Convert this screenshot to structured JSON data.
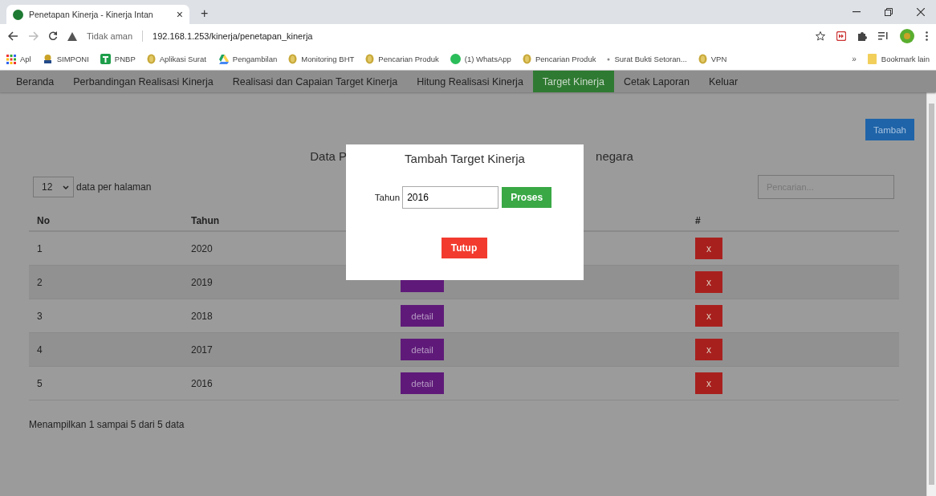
{
  "browser": {
    "tab_title": "Penetapan Kinerja - Kinerja Intan",
    "tab_close": "×",
    "new_tab": "+",
    "security": "Tidak aman",
    "url": "192.168.1.253/kinerja/penetapan_kinerja",
    "bookmarks": [
      {
        "label": "Apl",
        "kind": "grid"
      },
      {
        "label": "SIMPONI",
        "kind": "emblem"
      },
      {
        "label": "PNBP",
        "kind": "sheet"
      },
      {
        "label": "Aplikasi Surat",
        "kind": "coin"
      },
      {
        "label": "Pengambilan",
        "kind": "drive"
      },
      {
        "label": "Monitoring BHT",
        "kind": "coin"
      },
      {
        "label": "Pencarian Produk",
        "kind": "coin"
      },
      {
        "label": "(1) WhatsApp",
        "kind": "chat"
      },
      {
        "label": "Pencarian Produk",
        "kind": "coin"
      },
      {
        "label": "Surat Bukti Setoran...",
        "kind": "dot"
      },
      {
        "label": "VPN",
        "kind": "coin"
      }
    ],
    "more": "»",
    "other_bookmarks": "Bookmark lain"
  },
  "nav": [
    {
      "label": "Beranda",
      "selected": false
    },
    {
      "label": "Perbandingan Realisasi Kinerja",
      "selected": false
    },
    {
      "label": "Realisasi dan Capaian Target Kinerja",
      "selected": false
    },
    {
      "label": "Hitung Realisasi Kinerja",
      "selected": false
    },
    {
      "label": "Target Kinerja",
      "selected": true
    },
    {
      "label": "Cetak Laporan",
      "selected": false
    },
    {
      "label": "Keluar",
      "selected": false
    }
  ],
  "page": {
    "add_button": "Tambah",
    "title_left": "Data P",
    "title_right": "negara",
    "page_size": "12",
    "page_size_label": "data per halaman",
    "search": {
      "placeholder": "Pencarian..."
    },
    "columns": [
      "No",
      "Tahun",
      "#"
    ],
    "rows": [
      {
        "no": "1",
        "year": "2020",
        "detail": {
          "kind": "hidden"
        },
        "delete": "x"
      },
      {
        "no": "2",
        "year": "2019",
        "detail": {
          "kind": "covered"
        },
        "delete": "x"
      },
      {
        "no": "3",
        "year": "2018",
        "detail": {
          "kind": "full",
          "label": "detail"
        },
        "delete": "x"
      },
      {
        "no": "4",
        "year": "2017",
        "detail": {
          "kind": "full",
          "label": "detail"
        },
        "delete": "x"
      },
      {
        "no": "5",
        "year": "2016",
        "detail": {
          "kind": "full",
          "label": "detail"
        },
        "delete": "x"
      }
    ],
    "footer": "Menampilkan 1 sampai 5 dari 5 data"
  },
  "modal": {
    "title": "Tambah Target Kinerja",
    "field_label": "Tahun",
    "field_value": "2016",
    "submit": "Proses",
    "close": "Tutup"
  }
}
